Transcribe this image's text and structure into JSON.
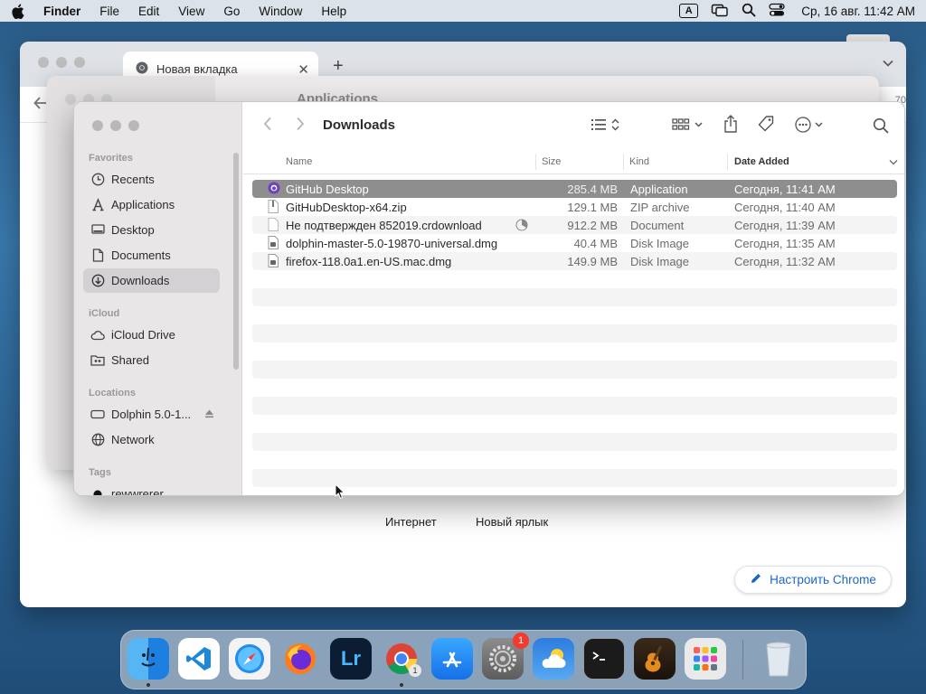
{
  "menubar": {
    "app_name": "Finder",
    "items": [
      "File",
      "Edit",
      "View",
      "Go",
      "Window",
      "Help"
    ],
    "input_source": "A",
    "clock": "Ср, 16 авг. 11:42 AM"
  },
  "chrome": {
    "tab_title": "Новая вкладка",
    "edge_number": "70",
    "shortcuts": [
      "Интернет",
      "Новый ярлык"
    ],
    "customize_label": "Настроить Chrome"
  },
  "finder_bg": {
    "title": "Applications"
  },
  "finder": {
    "title": "Downloads",
    "sections": {
      "favorites": "Favorites",
      "icloud": "iCloud",
      "locations": "Locations",
      "tags": "Tags"
    },
    "favorites": [
      "Recents",
      "Applications",
      "Desktop",
      "Documents",
      "Downloads"
    ],
    "icloud": [
      "iCloud Drive",
      "Shared"
    ],
    "locations": [
      "Dolphin 5.0-1...",
      "Network"
    ],
    "tags": [
      "rewwrerer"
    ],
    "selected_sidebar": "Downloads",
    "columns": {
      "name": "Name",
      "size": "Size",
      "kind": "Kind",
      "date": "Date Added"
    },
    "files": [
      {
        "name": "GitHub Desktop",
        "size": "285.4 MB",
        "kind": "Application",
        "date": "Сегодня, 11:41 AM",
        "icon": "github-app-icon"
      },
      {
        "name": "GitHubDesktop-x64.zip",
        "size": "129.1 MB",
        "kind": "ZIP archive",
        "date": "Сегодня, 11:40 AM",
        "icon": "zip-file-icon"
      },
      {
        "name": "Не подтвержден 852019.crdownload",
        "size": "912.2 MB",
        "kind": "Document",
        "date": "Сегодня, 11:39 AM",
        "icon": "document-icon"
      },
      {
        "name": "dolphin-master-5.0-19870-universal.dmg",
        "size": "40.4 MB",
        "kind": "Disk Image",
        "date": "Сегодня, 11:35 AM",
        "icon": "disk-image-icon"
      },
      {
        "name": "firefox-118.0a1.en-US.mac.dmg",
        "size": "149.9 MB",
        "kind": "Disk Image",
        "date": "Сегодня, 11:32 AM",
        "icon": "disk-image-icon"
      }
    ]
  },
  "dock": {
    "apps": [
      "Finder",
      "Visual Studio Code",
      "Safari",
      "Firefox",
      "Lightroom",
      "Google Chrome",
      "App Store",
      "System Settings",
      "Weather",
      "Terminal",
      "GarageBand",
      "Launchpad",
      "Trash"
    ],
    "lightroom_label": "Lr",
    "settings_badge": "1",
    "chrome_badge": "1"
  },
  "colors": {
    "selection_gray": "#8e8e8e",
    "chrome_accent": "#1a66c8",
    "badge_red": "#f23a2f"
  }
}
